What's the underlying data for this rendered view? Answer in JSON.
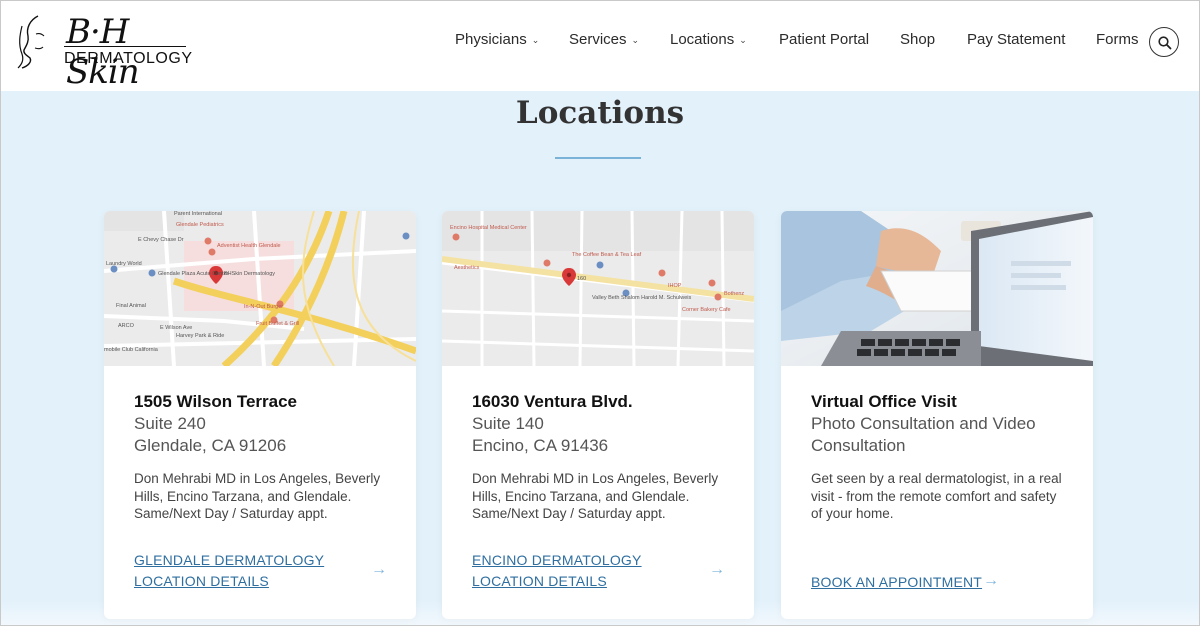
{
  "logo": {
    "script": "B·H Skin",
    "word": "DERMATOLOGY"
  },
  "nav": {
    "items": [
      {
        "label": "Physicians",
        "has_dropdown": true
      },
      {
        "label": "Services",
        "has_dropdown": true
      },
      {
        "label": "Locations",
        "has_dropdown": true
      },
      {
        "label": "Patient Portal",
        "has_dropdown": false
      },
      {
        "label": "Shop",
        "has_dropdown": false
      },
      {
        "label": "Pay Statement",
        "has_dropdown": false
      },
      {
        "label": "Forms",
        "has_dropdown": false
      }
    ],
    "chevron": "⌄",
    "search_icon": "search-icon"
  },
  "section": {
    "title": "Locations"
  },
  "cards": [
    {
      "heading": "1505 Wilson Terrace",
      "line1": "Suite 240",
      "line2": "Glendale, CA 91206",
      "description": "Don Mehrabi MD in Los Angeles, Beverly Hills, Encino Tarzana, and Glendale. Same/Next Day / Saturday appt.",
      "link_line1": "GLENDALE DERMATOLOGY",
      "link_line2": "LOCATION DETAILS",
      "arrow": "→",
      "map": {
        "pin_label": "BHSkin Dermatology",
        "labels": [
          "Parent International",
          "Glendale Pediatrics",
          "Adventist Health Glendale",
          "Laundry World",
          "Glendale Plaza Acute Center",
          "In-N-Out Burger",
          "Fruit Buffet & Grill",
          "E Wilson Ave",
          "Harvey Park & Ride",
          "ARCO",
          "E Chevy Chase Dr",
          "Final Animal",
          "mobile Club California"
        ]
      }
    },
    {
      "heading": "16030 Ventura Blvd.",
      "line1": "Suite 140",
      "line2": "Encino, CA 91436",
      "description": "Don Mehrabi MD in Los Angeles, Beverly Hills, Encino Tarzana, and Glendale. Same/Next Day / Saturday appt.",
      "link_line1": "ENCINO DERMATOLOGY",
      "link_line2": "LOCATION DETAILS",
      "arrow": "→",
      "map": {
        "pin_label": "160",
        "labels": [
          "Encino Hospital Medical Center",
          "The Coffee Bean & Tea Leaf",
          "Aesthetics",
          "Valley Beth Shalom Harold M. Schulweis",
          "IHOP",
          "Corner Bakery Cafe",
          "Bothenz"
        ]
      }
    },
    {
      "heading": "Virtual Office Visit",
      "line1": "Photo Consultation and Video",
      "line2": "Consultation",
      "description": "Get seen by a real dermatologist, in a real visit - from the remote comfort and safety of your home.",
      "link_line1": "BOOK AN APPOINTMENT",
      "link_line2": "",
      "arrow": "→"
    }
  ],
  "colors": {
    "accent": "#2f6fa0",
    "background": "#e3f1fb",
    "rule": "#7bb3d8",
    "pin": "#d93838",
    "freeway": "#f3cf5c"
  }
}
